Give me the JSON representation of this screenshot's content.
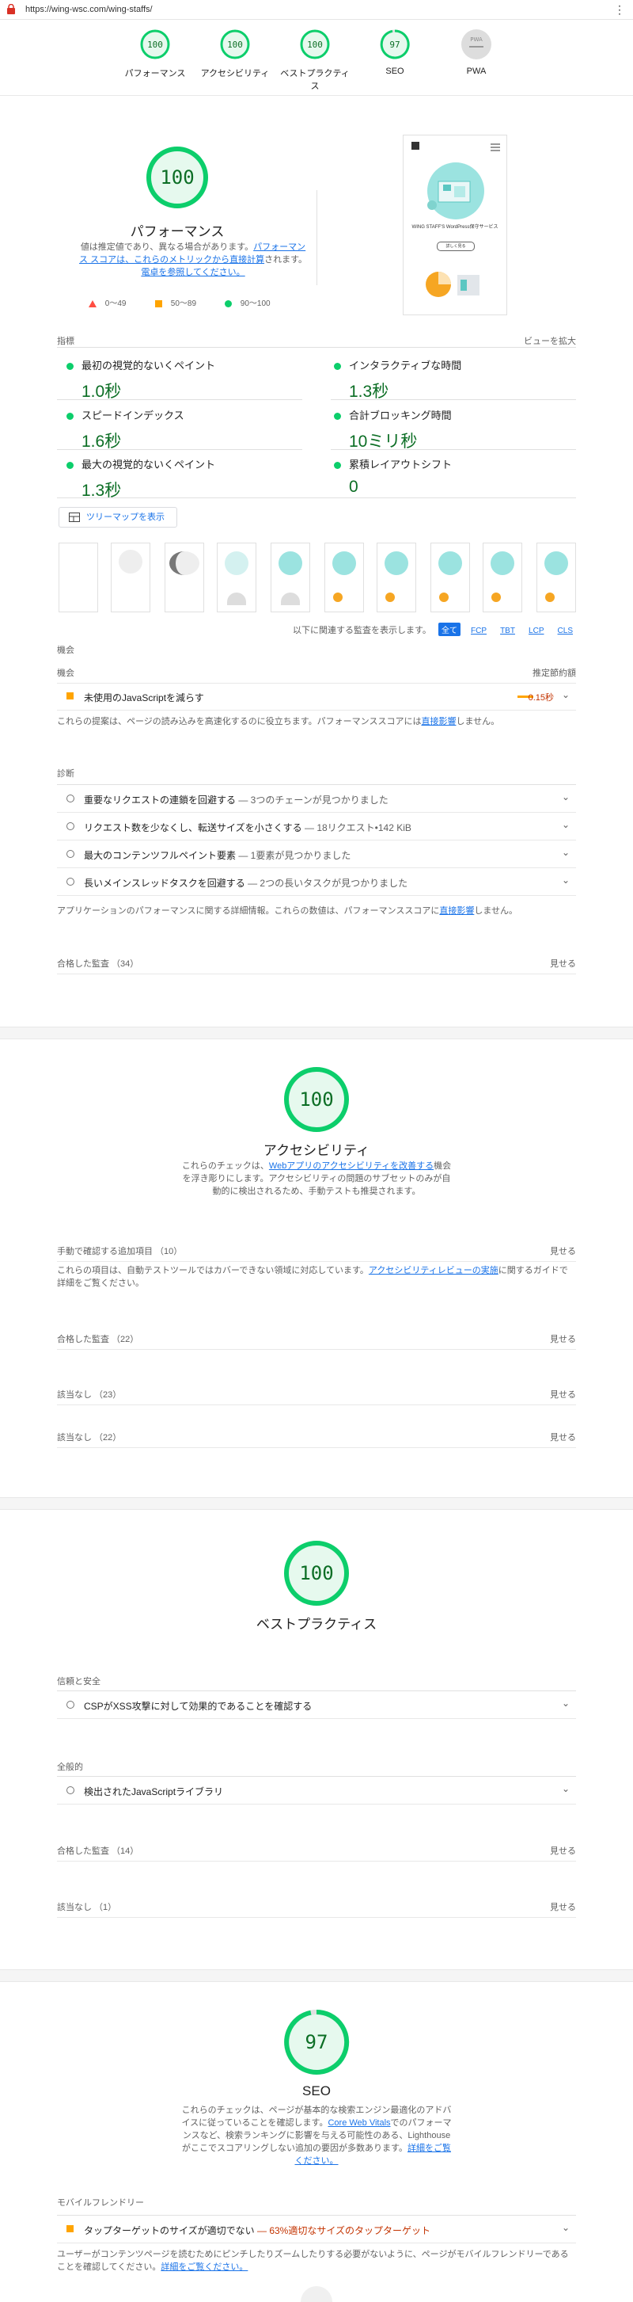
{
  "browser": {
    "url": "https://wing-wsc.com/wing-staffs/",
    "menu_glyph": "⋮"
  },
  "nav": [
    {
      "score": "100",
      "label": "パフォーマンス"
    },
    {
      "score": "100",
      "label": "アクセシビリティ"
    },
    {
      "score": "100",
      "label": "ベストプラクティス"
    },
    {
      "score": "97",
      "label": "SEO"
    },
    {
      "score": "PWA",
      "label": "PWA"
    }
  ],
  "colors": {
    "pass": "#0cce6b",
    "pass_text": "#0c6e25",
    "average": "#ffa400",
    "fail": "#ff4e42",
    "link": "#1a73e8"
  },
  "performance": {
    "score": "100",
    "title": "パフォーマンス",
    "desc_1": "値は推定値であり、異なる場合があります。",
    "desc_link_1": "パフォーマンス スコアは、これらのメトリックから直接計算",
    "desc_2": "されます。",
    "desc_link_2": "電卓を参照してください。",
    "legend": [
      {
        "label": "0～49"
      },
      {
        "label": "50～89"
      },
      {
        "label": "90～100"
      }
    ],
    "metrics_header": "指標",
    "expand_view": "ビューを拡大",
    "metrics": [
      {
        "name": "最初の視覚的ないくペイント",
        "value": "1.0秒"
      },
      {
        "name": "インタラクティブな時間",
        "value": "1.3秒"
      },
      {
        "name": "スピードインデックス",
        "value": "1.6秒"
      },
      {
        "name": "合計ブロッキング時間",
        "value": "10ミリ秒"
      },
      {
        "name": "最大の視覚的ないくペイント",
        "value": "1.3秒"
      },
      {
        "name": "累積レイアウトシフト",
        "value": "0"
      }
    ],
    "treemap_button": "ツリーマップを表示",
    "filter_label": "以下に関連する監査を表示します。",
    "filters": [
      "全て",
      "FCP",
      "TBT",
      "LCP",
      "CLS"
    ],
    "opportunities_header": "機会",
    "opp_col_left": "機会",
    "opp_col_right": "推定節約額",
    "opportunity": {
      "title": "未使用のJavaScriptを減らす",
      "savings": "0.15秒"
    },
    "opp_note_1": "これらの提案は、ページの読み込みを高速化するのに役立ちます。パフォーマンススコアには",
    "opp_note_link": "直接影響",
    "opp_note_2": "しません。",
    "diagnostics_header": "診断",
    "diagnostics": [
      {
        "title": "重要なリクエストの連鎖を回避する",
        "sub": " — 3つのチェーンが見つかりました"
      },
      {
        "title": "リクエスト数を少なくし、転送サイズを小さくする",
        "sub": " — 18リクエスト•142 KiB"
      },
      {
        "title": "最大のコンテンツフルペイント要素",
        "sub": " — 1要素が見つかりました"
      },
      {
        "title": "長いメインスレッドタスクを回避する",
        "sub": " — 2つの長いタスクが見つかりました"
      }
    ],
    "diag_note_1": "アプリケーションのパフォーマンスに関する詳細情報。これらの数値は、パフォーマンススコアに",
    "diag_note_link": "直接影響",
    "diag_note_2": "しません。",
    "passed": "合格した監査 （34）",
    "show": "見せる",
    "thumbnail_text": "WING STAFF'S WordPress保守サービス",
    "thumbnail_button": "詳しく見る"
  },
  "accessibility": {
    "score": "100",
    "title": "アクセシビリティ",
    "desc_1": "これらのチェックは、",
    "desc_link": "Webアプリのアクセシビリティを改善する",
    "desc_2": "機会を浮き彫りにします。アクセシビリティの問題のサブセットのみが自動的に検出されるため、手動テストも推奨されます。",
    "manual": "手動で確認する追加項目 （10）",
    "manual_note_1": "これらの項目は、自動テストツールではカバーできない領域に対応しています。",
    "manual_note_link": "アクセシビリティレビューの実施",
    "manual_note_2": "に関するガイドで詳細をご覧ください。",
    "passed": "合格した監査 （22）",
    "na_1": "該当なし （23）",
    "na_2": "該当なし （22）",
    "show": "見せる"
  },
  "best_practices": {
    "score": "100",
    "title": "ベストプラクティス",
    "trust_header": "信頼と安全",
    "trust_item": "CSPがXSS攻撃に対して効果的であることを確認する",
    "general_header": "全般的",
    "general_item": "検出されたJavaScriptライブラリ",
    "passed": "合格した監査 （14）",
    "na": "該当なし （1）",
    "show": "見せる"
  },
  "seo": {
    "score": "97",
    "title": "SEO",
    "desc_1": "これらのチェックは、ページが基本的な検索エンジン最適化のアドバイスに従っていることを確認します。",
    "desc_link_1": "Core Web Vitals",
    "desc_2": "でのパフォーマンスなど、検索ランキングに影響を与える可能性のある、Lighthouseがここでスコアリングしない追加の要因が多数あります。",
    "desc_link_2": "詳細をご覧ください。",
    "mobile_header": "モバイルフレンドリー",
    "mobile_item": "タップターゲットのサイズが適切でない",
    "mobile_sub": " — 63%適切なサイズのタップターゲット",
    "mobile_note_1": "ユーザーがコンテンツページを読むためにピンチしたりズームしたりする必要がないように、ページがモバイルフレンドリーであることを確認してください。",
    "mobile_note_link": "詳細をご覧ください。"
  }
}
